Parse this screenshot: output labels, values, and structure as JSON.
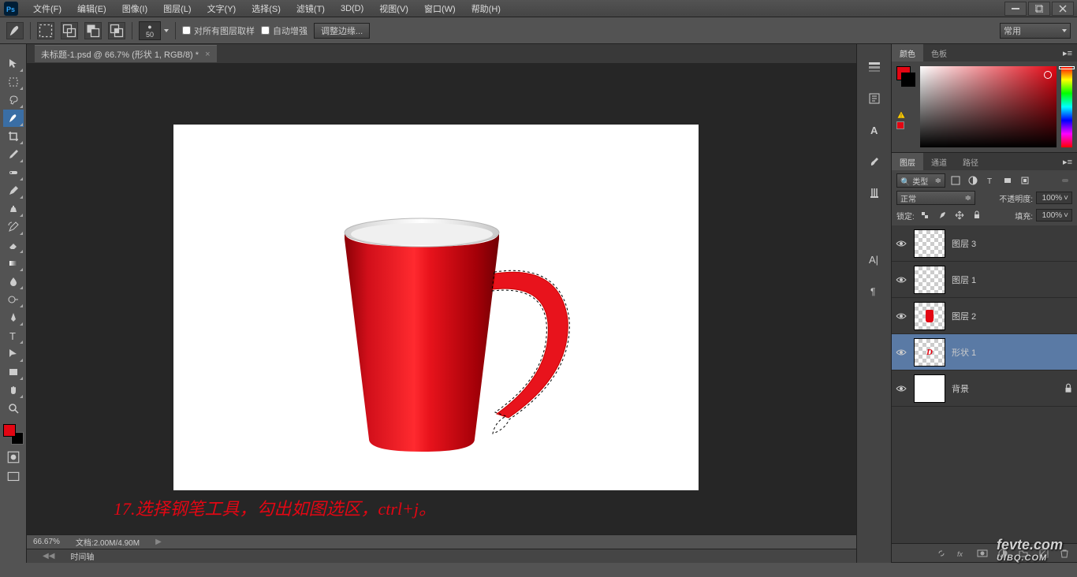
{
  "menu": {
    "items": [
      "文件(F)",
      "编辑(E)",
      "图像(I)",
      "图层(L)",
      "文字(Y)",
      "选择(S)",
      "滤镜(T)",
      "3D(D)",
      "视图(V)",
      "窗口(W)",
      "帮助(H)"
    ]
  },
  "options": {
    "brush_size": "50",
    "sample_all_layers": "对所有图层取样",
    "auto_enhance": "自动增强",
    "refine_edge": "调整边缘...",
    "workspace_preset": "常用"
  },
  "document": {
    "tab_title": "未标题-1.psd @ 66.7% (形状 1, RGB/8) *"
  },
  "annotation_text": "17.选择钢笔工具，勾出如图选区，ctrl+j。",
  "status": {
    "zoom": "66.67%",
    "doc_info": "文档:2.00M/4.90M"
  },
  "timeline_label": "时间轴",
  "color_panel": {
    "tab_color": "颜色",
    "tab_swatches": "色板"
  },
  "layers_panel": {
    "tab_layers": "图层",
    "tab_channels": "通道",
    "tab_paths": "路径",
    "filter_label": "类型",
    "blend_mode": "正常",
    "opacity_label": "不透明度:",
    "opacity_value": "100%",
    "lock_label": "锁定:",
    "fill_label": "填充:",
    "fill_value": "100%",
    "layers": [
      {
        "name": "图层 3",
        "thumb": "checker",
        "selected": false
      },
      {
        "name": "图层 1",
        "thumb": "checker",
        "selected": false
      },
      {
        "name": "图层 2",
        "thumb": "cup",
        "selected": false
      },
      {
        "name": "形状 1",
        "thumb": "handle",
        "selected": true
      },
      {
        "name": "背景",
        "thumb": "white",
        "selected": false,
        "locked": true
      }
    ]
  },
  "watermark": {
    "main": "fevte.com",
    "sub": "UIBQ.COM"
  }
}
